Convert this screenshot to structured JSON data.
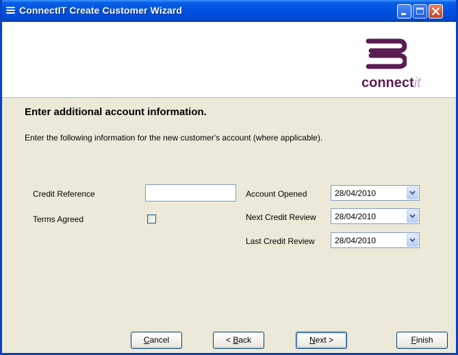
{
  "window": {
    "title": "ConnectIT Create Customer Wizard"
  },
  "logo": {
    "text_main": "connect",
    "text_accent": "it",
    "colors": {
      "primary": "#5a1c52",
      "accent": "#c8a7c8"
    }
  },
  "page": {
    "heading": "Enter additional account information.",
    "subtext": "Enter the following information for the new customer's account (where applicable)."
  },
  "form": {
    "credit_reference": {
      "label": "Credit Reference",
      "value": ""
    },
    "terms_agreed": {
      "label": "Terms Agreed",
      "checked": false
    },
    "account_opened": {
      "label": "Account Opened",
      "value": "28/04/2010"
    },
    "next_credit_review": {
      "label": "Next Credit Review",
      "value": "28/04/2010"
    },
    "last_credit_review": {
      "label": "Last Credit Review",
      "value": "28/04/2010"
    }
  },
  "buttons": {
    "cancel": {
      "accel": "C",
      "rest": "ancel"
    },
    "back": {
      "prefix": "< ",
      "accel": "B",
      "rest": "ack"
    },
    "next": {
      "accel": "N",
      "rest": "ext >"
    },
    "finish": {
      "accel": "F",
      "rest": "inish"
    }
  },
  "icons": {
    "app": "stacked-lines-icon",
    "minimize": "minimize-icon",
    "maximize": "maximize-icon",
    "close": "close-icon",
    "dropdown": "chevron-down-icon"
  },
  "colors": {
    "titlebar": "#0054e3",
    "dialog_bg": "#ece9d8",
    "close_button": "#c4401a"
  }
}
